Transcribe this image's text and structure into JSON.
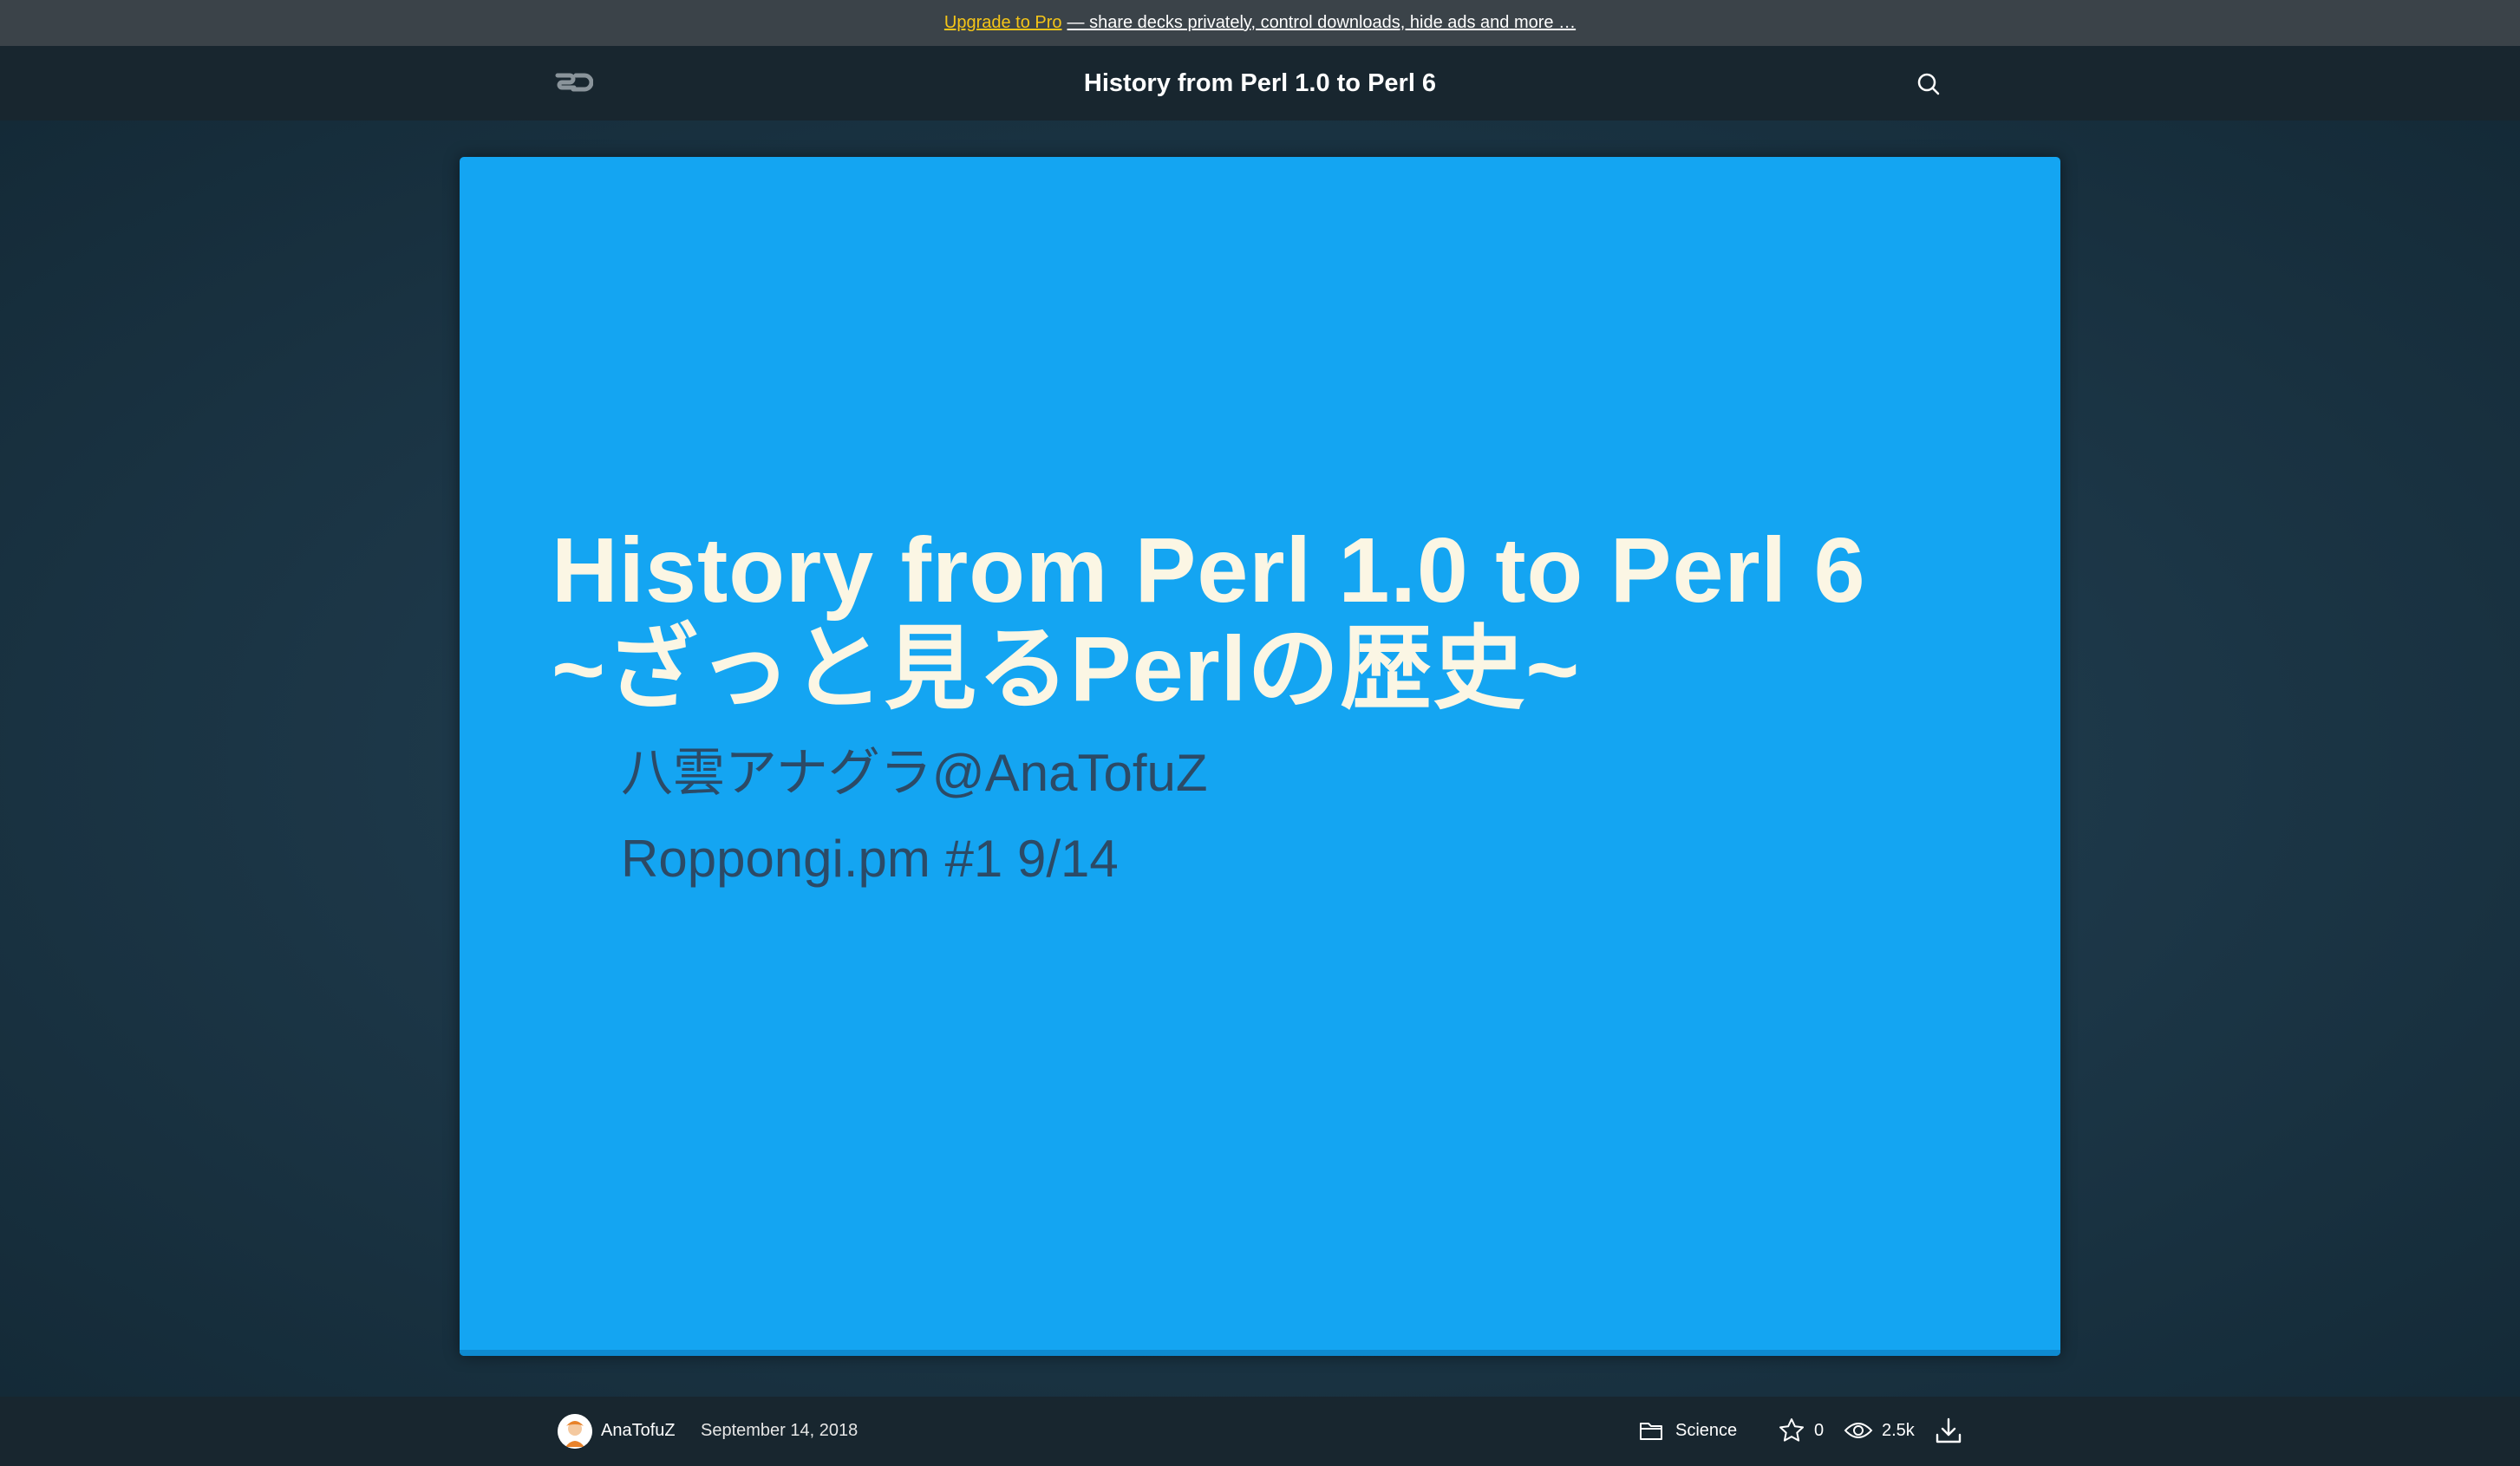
{
  "promo": {
    "upgrade_link": "Upgrade to Pro",
    "rest_text": "— share decks privately, control downloads, hide ads and more …"
  },
  "header": {
    "title": "History from Perl 1.0 to Perl 6",
    "logo_icon": "speakerdeck-logo-icon",
    "search_icon": "search-icon"
  },
  "slide": {
    "title_line1": "History from Perl 1.0 to Perl 6",
    "title_line2": "~ざっと見るPerlの歴史~",
    "author_line": "八雲アナグラ@AnaTofuZ",
    "event_line": "Roppongi.pm #1 9/14",
    "background_color": "#14a5f2",
    "title_color": "#fbf6e4",
    "subtitle_color": "#2c4a66"
  },
  "footer": {
    "author": "AnaTofuZ",
    "date": "September 14, 2018",
    "category": "Science",
    "stars": "0",
    "views": "2.5k",
    "icons": [
      "avatar",
      "folder-icon",
      "star-icon",
      "eye-icon",
      "download-icon"
    ]
  },
  "colors": {
    "promo_bg": "#3b4349",
    "promo_link": "#f5c518",
    "header_bg": "#18262f",
    "stage_bg": "#16303f"
  }
}
